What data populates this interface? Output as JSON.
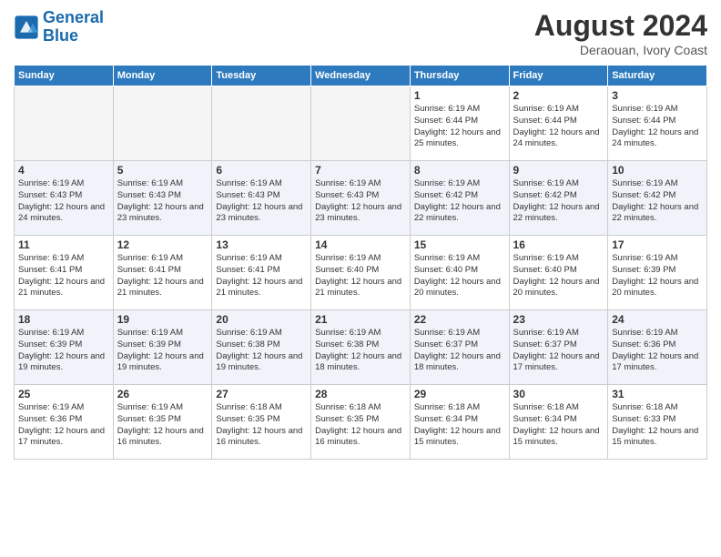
{
  "header": {
    "logo_line1": "General",
    "logo_line2": "Blue",
    "month": "August 2024",
    "location": "Deraouan, Ivory Coast"
  },
  "days_of_week": [
    "Sunday",
    "Monday",
    "Tuesday",
    "Wednesday",
    "Thursday",
    "Friday",
    "Saturday"
  ],
  "weeks": [
    [
      {
        "day": "",
        "empty": true
      },
      {
        "day": "",
        "empty": true
      },
      {
        "day": "",
        "empty": true
      },
      {
        "day": "",
        "empty": true
      },
      {
        "day": "1",
        "sunrise": "6:19 AM",
        "sunset": "6:44 PM",
        "daylight": "12 hours and 25 minutes."
      },
      {
        "day": "2",
        "sunrise": "6:19 AM",
        "sunset": "6:44 PM",
        "daylight": "12 hours and 24 minutes."
      },
      {
        "day": "3",
        "sunrise": "6:19 AM",
        "sunset": "6:44 PM",
        "daylight": "12 hours and 24 minutes."
      }
    ],
    [
      {
        "day": "4",
        "sunrise": "6:19 AM",
        "sunset": "6:43 PM",
        "daylight": "12 hours and 24 minutes."
      },
      {
        "day": "5",
        "sunrise": "6:19 AM",
        "sunset": "6:43 PM",
        "daylight": "12 hours and 23 minutes."
      },
      {
        "day": "6",
        "sunrise": "6:19 AM",
        "sunset": "6:43 PM",
        "daylight": "12 hours and 23 minutes."
      },
      {
        "day": "7",
        "sunrise": "6:19 AM",
        "sunset": "6:43 PM",
        "daylight": "12 hours and 23 minutes."
      },
      {
        "day": "8",
        "sunrise": "6:19 AM",
        "sunset": "6:42 PM",
        "daylight": "12 hours and 22 minutes."
      },
      {
        "day": "9",
        "sunrise": "6:19 AM",
        "sunset": "6:42 PM",
        "daylight": "12 hours and 22 minutes."
      },
      {
        "day": "10",
        "sunrise": "6:19 AM",
        "sunset": "6:42 PM",
        "daylight": "12 hours and 22 minutes."
      }
    ],
    [
      {
        "day": "11",
        "sunrise": "6:19 AM",
        "sunset": "6:41 PM",
        "daylight": "12 hours and 21 minutes."
      },
      {
        "day": "12",
        "sunrise": "6:19 AM",
        "sunset": "6:41 PM",
        "daylight": "12 hours and 21 minutes."
      },
      {
        "day": "13",
        "sunrise": "6:19 AM",
        "sunset": "6:41 PM",
        "daylight": "12 hours and 21 minutes."
      },
      {
        "day": "14",
        "sunrise": "6:19 AM",
        "sunset": "6:40 PM",
        "daylight": "12 hours and 21 minutes."
      },
      {
        "day": "15",
        "sunrise": "6:19 AM",
        "sunset": "6:40 PM",
        "daylight": "12 hours and 20 minutes."
      },
      {
        "day": "16",
        "sunrise": "6:19 AM",
        "sunset": "6:40 PM",
        "daylight": "12 hours and 20 minutes."
      },
      {
        "day": "17",
        "sunrise": "6:19 AM",
        "sunset": "6:39 PM",
        "daylight": "12 hours and 20 minutes."
      }
    ],
    [
      {
        "day": "18",
        "sunrise": "6:19 AM",
        "sunset": "6:39 PM",
        "daylight": "12 hours and 19 minutes."
      },
      {
        "day": "19",
        "sunrise": "6:19 AM",
        "sunset": "6:39 PM",
        "daylight": "12 hours and 19 minutes."
      },
      {
        "day": "20",
        "sunrise": "6:19 AM",
        "sunset": "6:38 PM",
        "daylight": "12 hours and 19 minutes."
      },
      {
        "day": "21",
        "sunrise": "6:19 AM",
        "sunset": "6:38 PM",
        "daylight": "12 hours and 18 minutes."
      },
      {
        "day": "22",
        "sunrise": "6:19 AM",
        "sunset": "6:37 PM",
        "daylight": "12 hours and 18 minutes."
      },
      {
        "day": "23",
        "sunrise": "6:19 AM",
        "sunset": "6:37 PM",
        "daylight": "12 hours and 17 minutes."
      },
      {
        "day": "24",
        "sunrise": "6:19 AM",
        "sunset": "6:36 PM",
        "daylight": "12 hours and 17 minutes."
      }
    ],
    [
      {
        "day": "25",
        "sunrise": "6:19 AM",
        "sunset": "6:36 PM",
        "daylight": "12 hours and 17 minutes."
      },
      {
        "day": "26",
        "sunrise": "6:19 AM",
        "sunset": "6:35 PM",
        "daylight": "12 hours and 16 minutes."
      },
      {
        "day": "27",
        "sunrise": "6:18 AM",
        "sunset": "6:35 PM",
        "daylight": "12 hours and 16 minutes."
      },
      {
        "day": "28",
        "sunrise": "6:18 AM",
        "sunset": "6:35 PM",
        "daylight": "12 hours and 16 minutes."
      },
      {
        "day": "29",
        "sunrise": "6:18 AM",
        "sunset": "6:34 PM",
        "daylight": "12 hours and 15 minutes."
      },
      {
        "day": "30",
        "sunrise": "6:18 AM",
        "sunset": "6:34 PM",
        "daylight": "12 hours and 15 minutes."
      },
      {
        "day": "31",
        "sunrise": "6:18 AM",
        "sunset": "6:33 PM",
        "daylight": "12 hours and 15 minutes."
      }
    ]
  ]
}
